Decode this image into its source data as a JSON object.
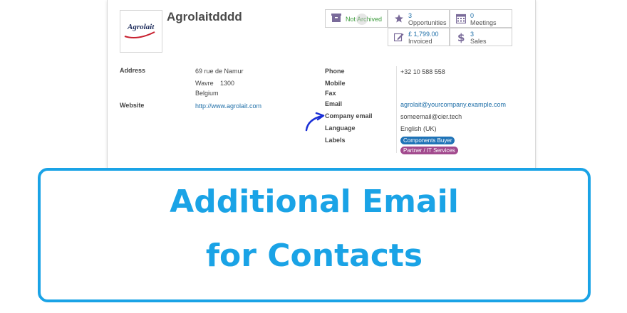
{
  "partner": {
    "name": "Agrolaitdddd",
    "logo_text": "Agrolait"
  },
  "smart_buttons": {
    "archive": {
      "label": "Not Archived",
      "icon": "archive-icon"
    },
    "opportunities": {
      "value": "3",
      "label": "Opportunities",
      "icon": "star-icon"
    },
    "meetings": {
      "value": "0",
      "label": "Meetings",
      "icon": "calendar-icon"
    },
    "invoiced": {
      "value": "£ 1,799.00",
      "label": "Invoiced",
      "icon": "pencil-square-icon"
    },
    "sales": {
      "value": "3",
      "label": "Sales",
      "icon": "dollar-icon"
    }
  },
  "left_fields": {
    "address_label": "Address",
    "street": "69 rue de Namur",
    "city": "Wavre",
    "zip": "1300",
    "country": "Belgium",
    "website_label": "Website",
    "website": "http://www.agrolait.com"
  },
  "right_fields": {
    "phone_label": "Phone",
    "phone": "+32 10 588 558",
    "mobile_label": "Mobile",
    "fax_label": "Fax",
    "email_label": "Email",
    "email": "agrolait@yourcompany.example.com",
    "company_email_label": "Company email",
    "company_email": "someemail@cier.tech",
    "language_label": "Language",
    "language": "English (UK)",
    "labels_label": "Labels",
    "tags": [
      "Components Buyer",
      "Partner / IT Services"
    ]
  },
  "banner": {
    "line1": "Additional Email",
    "line2": "for Contacts"
  },
  "colors": {
    "banner": "#1aa3e6",
    "link": "#1f6fa8",
    "tag_blue": "#1f73b7",
    "tag_purple": "#a24a8e",
    "archive_green": "#3a9a3a",
    "arrow": "#1a2fd6"
  }
}
